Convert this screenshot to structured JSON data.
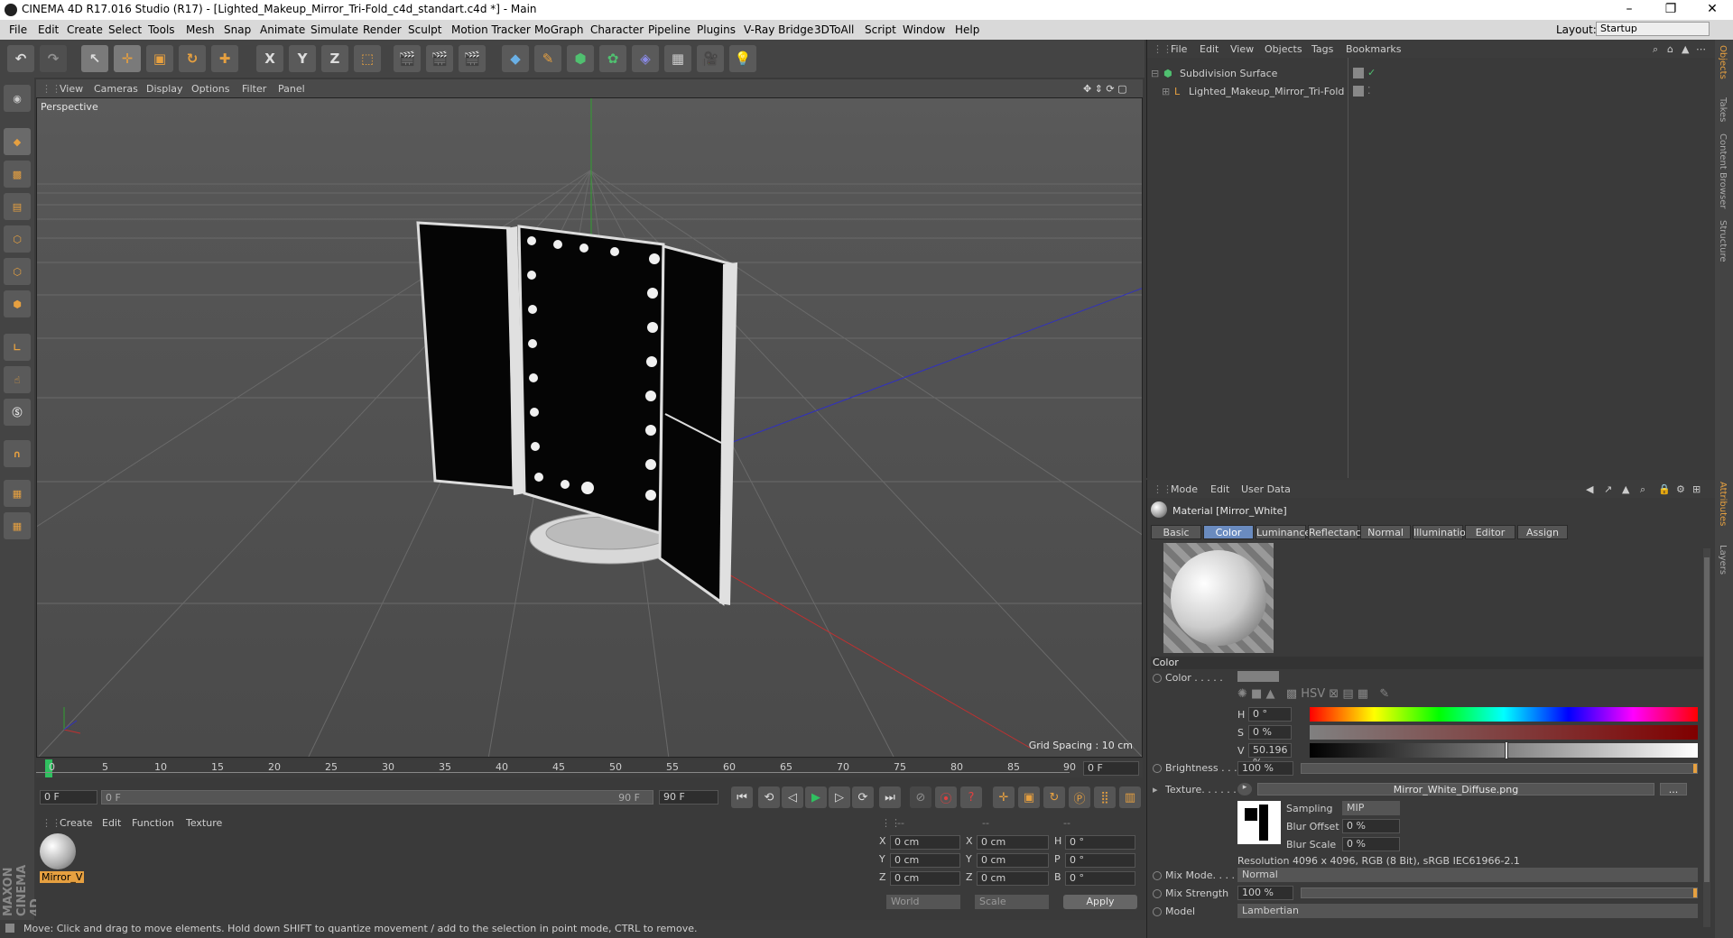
{
  "window": {
    "title": "CINEMA 4D R17.016 Studio (R17) - [Lighted_Makeup_Mirror_Tri-Fold_c4d_standart.c4d *] - Main",
    "min": "–",
    "max": "❐",
    "close": "✕"
  },
  "menubar": {
    "items": [
      "File",
      "Edit",
      "Create",
      "Select",
      "Tools",
      "Mesh",
      "Snap",
      "Animate",
      "Simulate",
      "Render",
      "Sculpt",
      "Motion Tracker",
      "MoGraph",
      "Character",
      "Pipeline",
      "Plugins",
      "V-Ray Bridge",
      "3DToAll",
      "Script",
      "Window",
      "Help"
    ],
    "layout_label": "Layout:",
    "layout_value": "Startup"
  },
  "toolbar": {
    "axis_x": "X",
    "axis_y": "Y",
    "axis_z": "Z"
  },
  "viewport": {
    "menu": [
      "View",
      "Cameras",
      "Display",
      "Options",
      "Filter",
      "Panel"
    ],
    "label": "Perspective",
    "grid_spacing": "Grid Spacing : 10 cm"
  },
  "timeline": {
    "ticks": [
      "0",
      "5",
      "10",
      "15",
      "20",
      "25",
      "30",
      "35",
      "40",
      "45",
      "50",
      "55",
      "60",
      "65",
      "70",
      "75",
      "80",
      "85",
      "90"
    ],
    "end_field": "0 F",
    "start": "0 F",
    "range_start": "0 F",
    "range_end": "90 F",
    "end": "90 F"
  },
  "material_manager": {
    "menu": [
      "Create",
      "Edit",
      "Function",
      "Texture"
    ],
    "material_name": "Mirror_V"
  },
  "coords": {
    "header": [
      "--",
      "--",
      "--"
    ],
    "rows": [
      {
        "a": "X",
        "av": "0 cm",
        "b": "X",
        "bv": "0 cm",
        "c": "H",
        "cv": "0 °"
      },
      {
        "a": "Y",
        "av": "0 cm",
        "b": "Y",
        "bv": "0 cm",
        "c": "P",
        "cv": "0 °"
      },
      {
        "a": "Z",
        "av": "0 cm",
        "b": "Z",
        "bv": "0 cm",
        "c": "B",
        "cv": "0 °"
      }
    ],
    "world": "World",
    "scale": "Scale",
    "apply": "Apply"
  },
  "status": "Move: Click and drag to move elements. Hold down SHIFT to quantize movement / add to the selection in point mode, CTRL to remove.",
  "objects": {
    "menu": [
      "File",
      "Edit",
      "View",
      "Objects",
      "Tags",
      "Bookmarks"
    ],
    "items": [
      {
        "name": "Subdivision Surface"
      },
      {
        "name": "Lighted_Makeup_Mirror_Tri-Fold"
      }
    ]
  },
  "attributes": {
    "menu": [
      "Mode",
      "Edit",
      "User Data"
    ],
    "material_title": "Material [Mirror_White]",
    "tabs": [
      "Basic",
      "Color",
      "Luminance",
      "Reflectance",
      "Normal",
      "Illumination",
      "Editor",
      "Assign"
    ],
    "active_tab": "Color",
    "section": "Color",
    "color_label": "Color . . . . .",
    "h_label": "H",
    "h_value": "0 °",
    "s_label": "S",
    "s_value": "0 %",
    "v_label": "V",
    "v_value": "50.196 %",
    "brightness_label": "Brightness . . .",
    "brightness_value": "100 %",
    "texture_label": "Texture. . . . . .",
    "texture_file": "Mirror_White_Diffuse.png",
    "texture_more": "...",
    "sampling_label": "Sampling",
    "sampling_value": "MIP",
    "blur_offset_label": "Blur Offset",
    "blur_offset_value": "0 %",
    "blur_scale_label": "Blur Scale",
    "blur_scale_value": "0 %",
    "resolution": "Resolution 4096 x 4096, RGB (8 Bit), sRGB IEC61966-2.1",
    "mix_mode_label": "Mix Mode. . . . .",
    "mix_mode_value": "Normal",
    "mix_strength_label": "Mix Strength",
    "mix_strength_value": "100 %",
    "model_label": "Model",
    "model_value": "Lambertian",
    "v_fraction": 0.50196
  },
  "right_tabs": [
    "Objects",
    "Takes",
    "Content Browser",
    "Structure",
    "Attributes",
    "Layers"
  ],
  "brand": "MAXON CINEMA 4D",
  "colors": {
    "accent": "#6a8bbf",
    "grid_axis_red": "#c03030",
    "grid_axis_green": "#30a030",
    "grid_axis_blue": "#3030c0"
  }
}
